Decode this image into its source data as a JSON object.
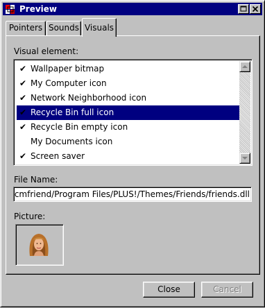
{
  "window": {
    "title": "Preview",
    "colors": {
      "titlebar": "#000080",
      "face": "#c0c0c0",
      "selection": "#000080"
    }
  },
  "tabs": [
    {
      "label": "Pointers",
      "active": false
    },
    {
      "label": "Sounds",
      "active": false
    },
    {
      "label": "Visuals",
      "active": true
    }
  ],
  "visual_element": {
    "label": "Visual element:",
    "items": [
      {
        "label": "Wallpaper bitmap",
        "checked": true,
        "selected": false
      },
      {
        "label": "My Computer icon",
        "checked": true,
        "selected": false
      },
      {
        "label": "Network Neighborhood icon",
        "checked": true,
        "selected": false
      },
      {
        "label": "Recycle Bin full icon",
        "checked": true,
        "selected": true
      },
      {
        "label": "Recycle Bin empty icon",
        "checked": true,
        "selected": false
      },
      {
        "label": "My Documents icon",
        "checked": false,
        "selected": false
      },
      {
        "label": "Screen saver",
        "checked": true,
        "selected": false
      }
    ],
    "check_glyph": "✔"
  },
  "file_name": {
    "label": "File Name:",
    "value": "ds/cmfriend/Program Files/PLUS!/Themes/Friends/friends.dll"
  },
  "picture": {
    "label": "Picture:",
    "icon": "portrait-icon"
  },
  "buttons": {
    "close": "Close",
    "cancel": "Cancel",
    "cancel_disabled": true
  }
}
